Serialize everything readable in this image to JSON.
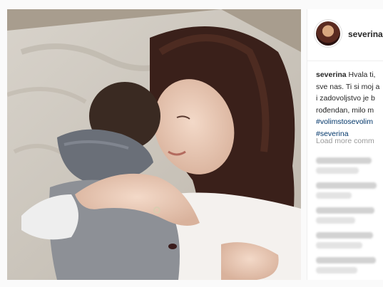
{
  "post": {
    "photo_alt": "",
    "header": {
      "username": "severina"
    },
    "caption": {
      "username": "severina",
      "lines": [
        "Hvala ti,",
        "sve nas. Ti si moj a",
        "i zadovoljstvo je b",
        "rođendan, milo m"
      ],
      "hashtags": [
        "#volimstosevolim",
        "#severina"
      ]
    },
    "load_more": "Load more comm"
  },
  "colors": {
    "link": "#003569",
    "text": "#262626",
    "muted": "#999999"
  },
  "icons": {
    "avatar": "profile-avatar"
  }
}
